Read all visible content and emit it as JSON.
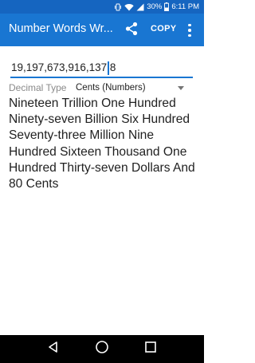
{
  "status_bar": {
    "battery_percent": "30%",
    "time": "6:11 PM",
    "icons": [
      "wifi-icon",
      "signal-icon",
      "battery-icon"
    ]
  },
  "app_bar": {
    "title": "Number Words Wr...",
    "copy_label": "COPY",
    "icons": [
      "share-icon",
      "overflow-menu-icon"
    ],
    "color": "#1976d2"
  },
  "number_input": {
    "value": "19,197,673,916,137.8"
  },
  "decimal_type": {
    "label": "Decimal Type",
    "selected": "Cents (Numbers)"
  },
  "result": {
    "text": "Nineteen Trillion One Hundred Ninety-seven Billion Six Hundred Seventy-three Million Nine Hundred Sixteen Thousand One Hundred Thirty-seven Dollars And 80 Cents"
  },
  "nav_bar": {
    "icons": [
      "back-icon",
      "home-icon",
      "recents-icon"
    ]
  }
}
